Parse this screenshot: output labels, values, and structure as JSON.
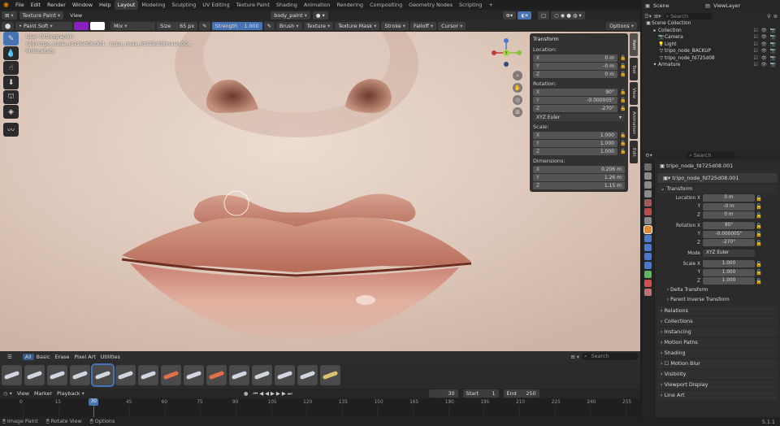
{
  "menu": {
    "items": [
      "File",
      "Edit",
      "Render",
      "Window",
      "Help"
    ],
    "workspaces": [
      "Layout",
      "Modeling",
      "Sculpting",
      "UV Editing",
      "Texture Paint",
      "Shading",
      "Animation",
      "Rendering",
      "Compositing",
      "Geometry Nodes",
      "Scripting",
      "+"
    ],
    "active_workspace": "Layout",
    "scene": "Scene",
    "view_layer": "ViewLayer"
  },
  "header": {
    "mode": "Texture Paint",
    "view": "View",
    "object": "body_paint"
  },
  "toolsettings": {
    "brush": "Paint Soft",
    "blend": "Mix",
    "size_label": "Size",
    "size": "65 px",
    "strength_label": "Strength",
    "strength": "1.000",
    "menus": [
      "Brush",
      "Texture",
      "Texture Mask",
      "Stroke",
      "Falloff",
      "Cursor"
    ],
    "options": "Options",
    "color": "#8a1fc0"
  },
  "viewport": {
    "info": [
      "User Orthographic",
      "(30) tripo_node_fd725d08.001 : tripo_node_fd725d08mesh.00...",
      "Millimeters"
    ]
  },
  "npanel": {
    "title": "Transform",
    "location_label": "Location:",
    "location": [
      [
        "X",
        "0 m"
      ],
      [
        "Y",
        "-0 m"
      ],
      [
        "Z",
        "0 m"
      ]
    ],
    "rotation_label": "Rotation:",
    "rotation": [
      [
        "X",
        "90°"
      ],
      [
        "Y",
        "-0.000005°"
      ],
      [
        "Z",
        "-270°"
      ]
    ],
    "rotation_mode": "XYZ Euler",
    "scale_label": "Scale:",
    "scale": [
      [
        "X",
        "1.000"
      ],
      [
        "Y",
        "1.000"
      ],
      [
        "Z",
        "1.000"
      ]
    ],
    "dimensions_label": "Dimensions:",
    "dimensions": [
      [
        "X",
        "0.206 m"
      ],
      [
        "Y",
        "1.26 m"
      ],
      [
        "Z",
        "1.15 m"
      ]
    ],
    "tabs": [
      "Item",
      "Tool",
      "View",
      "Animation",
      "Edit"
    ]
  },
  "asset": {
    "tabs": [
      "All",
      "Basic",
      "Erase",
      "Pixel Art",
      "Utilities"
    ],
    "search": "Search",
    "brush_count": 15
  },
  "timeline": {
    "menus": [
      "View",
      "Marker",
      "Playback"
    ],
    "current": "30",
    "start_label": "Start",
    "start": "1",
    "end_label": "End",
    "end": "250",
    "ticks": [
      "0",
      "15",
      "30",
      "45",
      "60",
      "75",
      "90",
      "105",
      "120",
      "135",
      "150",
      "165",
      "180",
      "195",
      "210",
      "225",
      "240",
      "255"
    ]
  },
  "status": {
    "items": [
      "Image Paint",
      "Rotate View",
      "Options"
    ],
    "version": "5.1.1"
  },
  "outliner": {
    "search": "Search",
    "rows": [
      {
        "name": "Scene Collection",
        "indent": 0,
        "icon": "▣"
      },
      {
        "name": "Collection",
        "indent": 1,
        "icon": "▸"
      },
      {
        "name": "Camera",
        "indent": 2,
        "icon": "📷"
      },
      {
        "name": "Light",
        "indent": 2,
        "icon": "💡"
      },
      {
        "name": "tripo_node_BACKUP",
        "indent": 2,
        "icon": "▽"
      },
      {
        "name": "tripo_node_fd725d08",
        "indent": 2,
        "icon": "▽"
      },
      {
        "name": "Armature",
        "indent": 1,
        "icon": "✦"
      }
    ]
  },
  "properties": {
    "search": "Search",
    "object_name": "tripo_node_fd725d08.001",
    "object_field": "tripo_node_fd725d08.001",
    "transform": "Transform",
    "rows": [
      [
        "Location X",
        "0 m"
      ],
      [
        "Y",
        "-0 m"
      ],
      [
        "Z",
        "0 m"
      ],
      [
        "Rotation X",
        "90°"
      ],
      [
        "Y",
        "-0.000005°"
      ],
      [
        "Z",
        "-270°"
      ],
      [
        "Mode",
        "XYZ Euler"
      ],
      [
        "Scale X",
        "1.000"
      ],
      [
        "Y",
        "1.000"
      ],
      [
        "Z",
        "1.000"
      ]
    ],
    "subsections": [
      "Delta Transform",
      "Parent Inverse Transform"
    ],
    "sections": [
      "Relations",
      "Collections",
      "Instancing",
      "Motion Paths",
      "Shading",
      "Motion Blur",
      "Visibility",
      "Viewport Display",
      "Line Art"
    ]
  }
}
